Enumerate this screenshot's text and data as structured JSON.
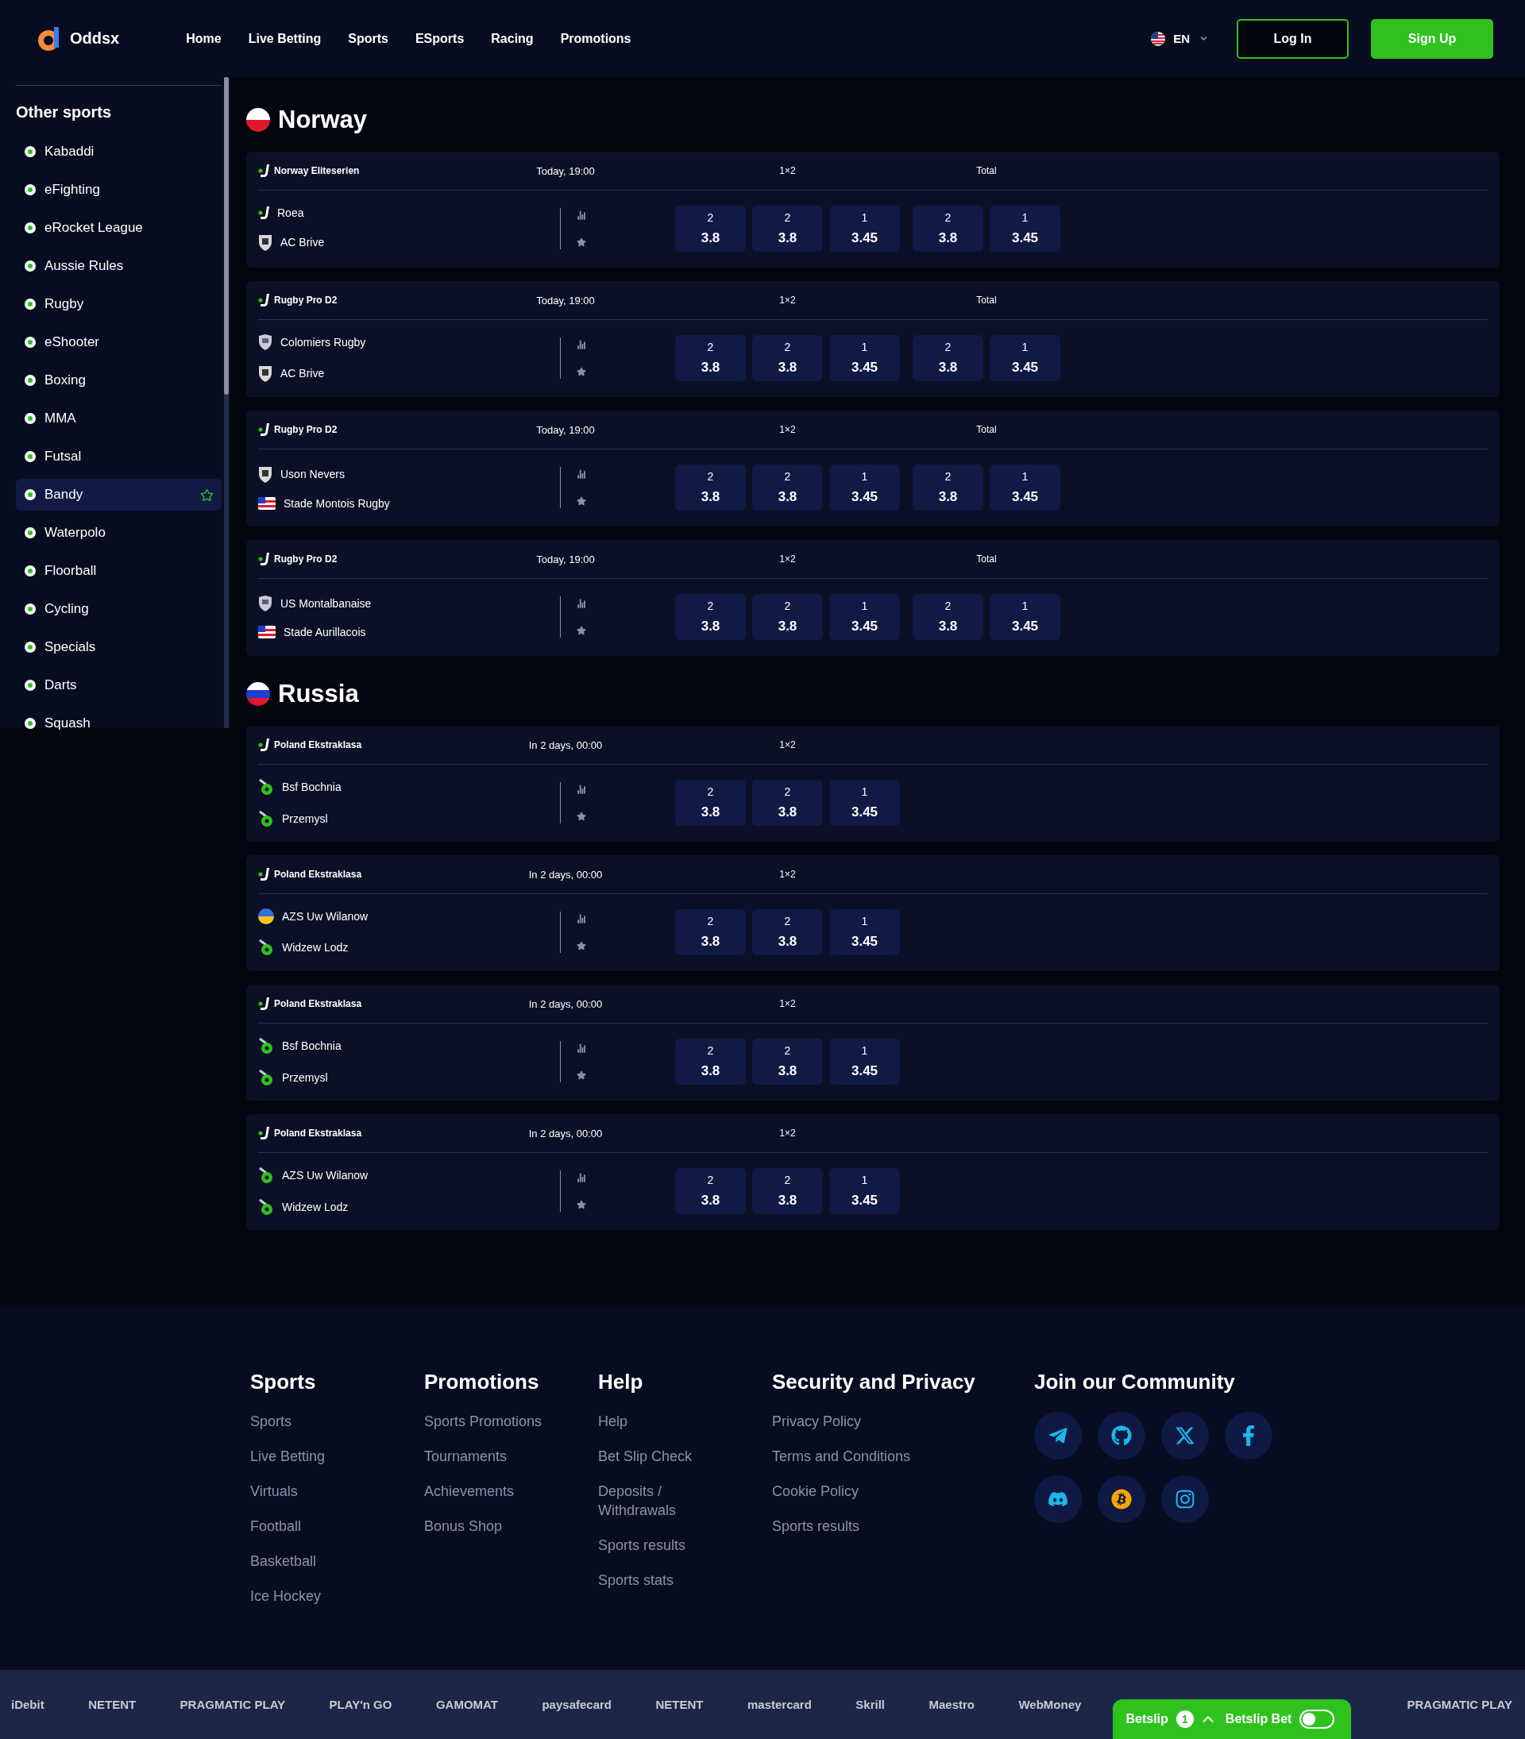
{
  "header": {
    "brand": "Oddsx",
    "nav": [
      {
        "label": "Home"
      },
      {
        "label": "Live Betting"
      },
      {
        "label": "Sports"
      },
      {
        "label": "ESports"
      },
      {
        "label": "Racing"
      },
      {
        "label": "Promotions"
      }
    ],
    "language": "EN",
    "login": "Log In",
    "signup": "Sign Up"
  },
  "sidebar": {
    "title": "Other sports",
    "items": [
      {
        "label": "Kabaddi",
        "selected": false
      },
      {
        "label": "eFighting",
        "selected": false
      },
      {
        "label": "eRocket League",
        "selected": false
      },
      {
        "label": "Aussie Rules",
        "selected": false
      },
      {
        "label": "Rugby",
        "selected": false
      },
      {
        "label": "eShooter",
        "selected": false
      },
      {
        "label": "Boxing",
        "selected": false
      },
      {
        "label": "MMA",
        "selected": false
      },
      {
        "label": "Futsal",
        "selected": false
      },
      {
        "label": "Bandy",
        "selected": true
      },
      {
        "label": "Waterpolo",
        "selected": false
      },
      {
        "label": "Floorball",
        "selected": false
      },
      {
        "label": "Cycling",
        "selected": false
      },
      {
        "label": "Specials",
        "selected": false
      },
      {
        "label": "Darts",
        "selected": false
      },
      {
        "label": "Squash",
        "selected": false
      }
    ]
  },
  "sections": [
    {
      "country": "Norway",
      "kind": "bicolor",
      "matches": [
        {
          "league": "Norway Eliteserien",
          "time": "Today, 19:00",
          "teams": [
            {
              "name": "Roea",
              "kind": "stick"
            },
            {
              "name": "AC Brive",
              "kind": "crest"
            }
          ],
          "markets": [
            {
              "label": "1×2",
              "odds": [
                {
                  "pick": "2",
                  "price": "3.8"
                },
                {
                  "pick": "2",
                  "price": "3.8"
                },
                {
                  "pick": "1",
                  "price": "3.45"
                }
              ]
            },
            {
              "label": "Total",
              "odds": [
                {
                  "pick": "2",
                  "price": "3.8"
                },
                {
                  "pick": "1",
                  "price": "3.45"
                }
              ]
            }
          ]
        },
        {
          "league": "Rugby Pro D2",
          "time": "Today, 19:00",
          "teams": [
            {
              "name": "Colomiers Rugby",
              "kind": "shield"
            },
            {
              "name": "AC Brive",
              "kind": "crest"
            }
          ],
          "markets": [
            {
              "label": "1×2",
              "odds": [
                {
                  "pick": "2",
                  "price": "3.8"
                },
                {
                  "pick": "2",
                  "price": "3.8"
                },
                {
                  "pick": "1",
                  "price": "3.45"
                }
              ]
            },
            {
              "label": "Total",
              "odds": [
                {
                  "pick": "2",
                  "price": "3.8"
                },
                {
                  "pick": "1",
                  "price": "3.45"
                }
              ]
            }
          ]
        },
        {
          "league": "Rugby Pro D2",
          "time": "Today, 19:00",
          "teams": [
            {
              "name": "Uson Nevers",
              "kind": "crest"
            },
            {
              "name": "Stade Montois Rugby",
              "kind": "flag"
            }
          ],
          "markets": [
            {
              "label": "1×2",
              "odds": [
                {
                  "pick": "2",
                  "price": "3.8"
                },
                {
                  "pick": "2",
                  "price": "3.8"
                },
                {
                  "pick": "1",
                  "price": "3.45"
                }
              ]
            },
            {
              "label": "Total",
              "odds": [
                {
                  "pick": "2",
                  "price": "3.8"
                },
                {
                  "pick": "1",
                  "price": "3.45"
                }
              ]
            }
          ]
        },
        {
          "league": "Rugby Pro D2",
          "time": "Today, 19:00",
          "teams": [
            {
              "name": "US Montalbanaise",
              "kind": "shield"
            },
            {
              "name": "Stade Aurillacois",
              "kind": "flag"
            }
          ],
          "markets": [
            {
              "label": "1×2",
              "odds": [
                {
                  "pick": "2",
                  "price": "3.8"
                },
                {
                  "pick": "2",
                  "price": "3.8"
                },
                {
                  "pick": "1",
                  "price": "3.45"
                }
              ]
            },
            {
              "label": "Total",
              "odds": [
                {
                  "pick": "2",
                  "price": "3.8"
                },
                {
                  "pick": "1",
                  "price": "3.45"
                }
              ]
            }
          ]
        }
      ]
    },
    {
      "country": "Russia",
      "kind": "tricolor",
      "matches": [
        {
          "league": "Poland Ekstraklasa",
          "time": "In 2 days, 00:00",
          "teams": [
            {
              "name": "Bsf Bochnia",
              "kind": "ball"
            },
            {
              "name": "Przemysl",
              "kind": "ball"
            }
          ],
          "markets": [
            {
              "label": "1×2",
              "odds": [
                {
                  "pick": "2",
                  "price": "3.8"
                },
                {
                  "pick": "2",
                  "price": "3.8"
                },
                {
                  "pick": "1",
                  "price": "3.45"
                }
              ]
            }
          ]
        },
        {
          "league": "Poland Ekstraklasa",
          "time": "In 2 days, 00:00",
          "teams": [
            {
              "name": "AZS Uw Wilanow",
              "kind": "globe"
            },
            {
              "name": "Widzew Lodz",
              "kind": "ball"
            }
          ],
          "markets": [
            {
              "label": "1×2",
              "odds": [
                {
                  "pick": "2",
                  "price": "3.8"
                },
                {
                  "pick": "2",
                  "price": "3.8"
                },
                {
                  "pick": "1",
                  "price": "3.45"
                }
              ]
            }
          ]
        },
        {
          "league": "Poland Ekstraklasa",
          "time": "In 2 days, 00:00",
          "teams": [
            {
              "name": "Bsf Bochnia",
              "kind": "ball"
            },
            {
              "name": "Przemysl",
              "kind": "ball"
            }
          ],
          "markets": [
            {
              "label": "1×2",
              "odds": [
                {
                  "pick": "2",
                  "price": "3.8"
                },
                {
                  "pick": "2",
                  "price": "3.8"
                },
                {
                  "pick": "1",
                  "price": "3.45"
                }
              ]
            }
          ]
        },
        {
          "league": "Poland Ekstraklasa",
          "time": "In 2 days, 00:00",
          "teams": [
            {
              "name": "AZS Uw Wilanow",
              "kind": "ball"
            },
            {
              "name": "Widzew Lodz",
              "kind": "ball"
            }
          ],
          "markets": [
            {
              "label": "1×2",
              "odds": [
                {
                  "pick": "2",
                  "price": "3.8"
                },
                {
                  "pick": "2",
                  "price": "3.8"
                },
                {
                  "pick": "1",
                  "price": "3.45"
                }
              ]
            }
          ]
        }
      ]
    }
  ],
  "footer": {
    "columns": [
      {
        "title": "Sports",
        "links": [
          "Sports",
          "Live Betting",
          "Virtuals",
          "Football",
          "Basketball",
          "Ice Hockey"
        ]
      },
      {
        "title": "Promotions",
        "links": [
          "Sports Promotions",
          "Tournaments",
          "Achievements",
          "Bonus Shop"
        ]
      },
      {
        "title": "Help",
        "links": [
          "Help",
          "Bet Slip Check",
          "Deposits / Withdrawals",
          "Sports results",
          "Sports stats"
        ]
      },
      {
        "title": "Security and Privacy",
        "links": [
          "Privacy Policy",
          "Terms and Conditions",
          "Cookie Policy",
          "Sports results"
        ]
      }
    ],
    "community_title": "Join our Community"
  },
  "payment_logos": [
    "iDebit",
    "NETENT",
    "PRAGMATIC PLAY",
    "PLAY'n GO",
    "GAMOMAT",
    "paysafecard",
    "NETENT",
    "mastercard",
    "Skrill",
    "Maestro",
    "WebMoney"
  ],
  "payment_logos_end": [
    "PRAGMATIC PLAY"
  ],
  "betslip": {
    "label": "Betslip",
    "count": "1",
    "bet_label": "Betslip Bet",
    "on": false
  }
}
